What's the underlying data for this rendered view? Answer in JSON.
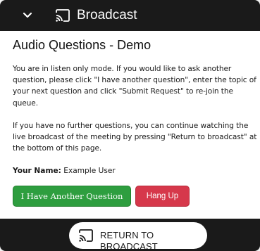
{
  "header": {
    "title": "Broadcast",
    "collapse_icon": "chevron-down-icon",
    "cast_icon": "cast-icon"
  },
  "main": {
    "heading": "Audio Questions - Demo",
    "paragraph1": "You are in listen only mode. If you would like to ask another question, please click \"I have another question\", enter the topic of your next question and click \"Submit Request\" to re-join the queue.",
    "paragraph2": "If you have no further questions, you can continue watching the live broadcast of the meeting by pressing \"Return to broadcast\" at the bottom of this page.",
    "name_label": "Your Name:",
    "name_value": "Example User",
    "another_question_label": "I Have Another Question",
    "hang_up_label": "Hang Up"
  },
  "footer": {
    "return_label": "RETURN TO BROADCAST",
    "cast_icon": "cast-icon"
  },
  "colors": {
    "header_bg": "#1a1a1a",
    "green_button": "#2e9e3f",
    "red_button": "#d6384b"
  }
}
